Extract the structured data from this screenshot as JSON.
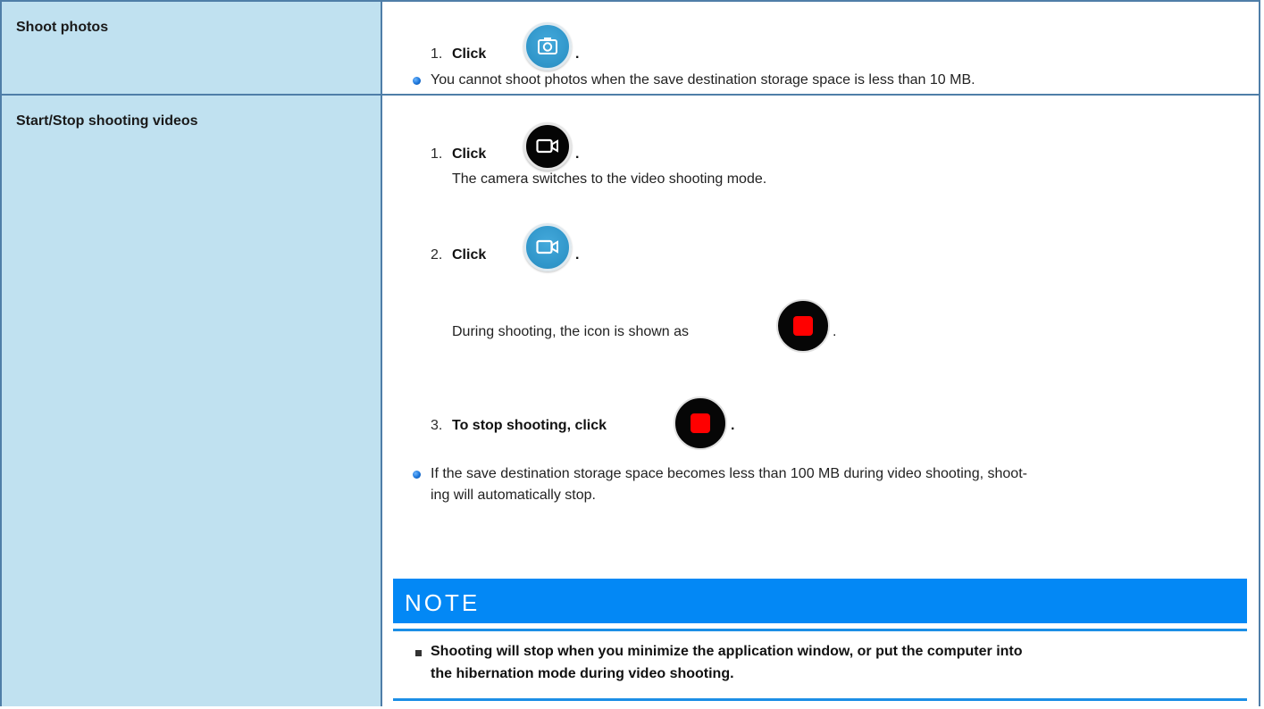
{
  "rows": [
    {
      "label": "Shoot photos",
      "steps": [
        {
          "num": "1.",
          "text": "Click",
          "after": ".",
          "icon": "camera-icon"
        }
      ],
      "bullets": [
        "You cannot shoot photos when the save destination storage space is less than 10 MB."
      ]
    },
    {
      "label": "Start/Stop shooting videos",
      "steps": [
        {
          "num": "1.",
          "text": "Click",
          "after": ".",
          "icon": "video-camera-icon",
          "detail": "The camera switches to the video shooting mode."
        },
        {
          "num": "2.",
          "text": "Click",
          "after": ".",
          "icon": "video-camera-icon",
          "detail": "During shooting, the icon is shown as",
          "detail_after": ".",
          "detail_icon": "stop-recording-icon"
        },
        {
          "num": "3.",
          "text": "To stop shooting, click",
          "after": ".",
          "icon": "stop-recording-icon"
        }
      ],
      "bullets": [
        "If the save destination storage space becomes less than 100 MB during video shooting, shoot-",
        "ing will automatically stop."
      ],
      "note": {
        "title": "NOTE",
        "items": [
          "Shooting will stop when you minimize the application window, or put the computer into",
          "the hibernation mode during video shooting."
        ]
      }
    }
  ],
  "colors": {
    "label_background": "#c0e1f0",
    "border": "#4f7ea8",
    "note_bar": "#0388f5",
    "blue_icon": "#2f95c9",
    "stop_square": "#ff0000"
  }
}
